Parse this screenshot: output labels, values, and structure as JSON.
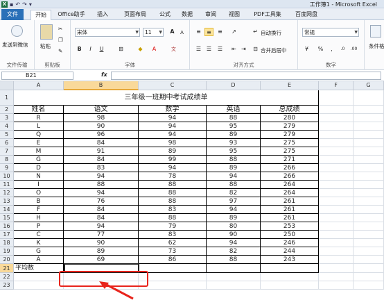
{
  "window": {
    "title": "工作簿1 - Microsoft Excel"
  },
  "tabs": [
    "文件",
    "开始",
    "Office助手",
    "插入",
    "页面布局",
    "公式",
    "数据",
    "审阅",
    "视图",
    "PDF工具集",
    "百度网盘"
  ],
  "ribbon": {
    "wechat": "发送到微信",
    "file_transfer": "文件传输",
    "paste": "粘贴",
    "clipboard": "剪贴板",
    "font_name": "宋体",
    "font_size": "11",
    "font_group": "字体",
    "wrap_text": "自动换行",
    "merge_center": "合并后居中",
    "alignment_group": "对齐方式",
    "number_format": "常规",
    "number_group": "数字",
    "conditional": "条件格",
    "bold": "B",
    "italic": "I",
    "underline": "U",
    "grow_font": "A",
    "shrink_font": "A"
  },
  "formula_bar": {
    "name_box": "B21",
    "fx": "fx",
    "value": ""
  },
  "columns": [
    "A",
    "B",
    "C",
    "D",
    "E",
    "F",
    "G"
  ],
  "rows": [
    "1",
    "2",
    "3",
    "4",
    "5",
    "6",
    "7",
    "8",
    "9",
    "10",
    "11",
    "12",
    "13",
    "14",
    "15",
    "16",
    "17",
    "18",
    "19",
    "20",
    "21",
    "22",
    "23"
  ],
  "sheet": {
    "title": "三年级一班期中考试成绩单",
    "headers": [
      "姓名",
      "语文",
      "数学",
      "英语",
      "总成绩"
    ],
    "records": [
      [
        "R",
        "98",
        "94",
        "88",
        "280"
      ],
      [
        "L",
        "90",
        "94",
        "95",
        "279"
      ],
      [
        "Q",
        "96",
        "94",
        "89",
        "279"
      ],
      [
        "E",
        "84",
        "98",
        "93",
        "275"
      ],
      [
        "M",
        "91",
        "89",
        "95",
        "275"
      ],
      [
        "G",
        "84",
        "99",
        "88",
        "271"
      ],
      [
        "D",
        "83",
        "94",
        "89",
        "266"
      ],
      [
        "N",
        "94",
        "78",
        "94",
        "266"
      ],
      [
        "I",
        "88",
        "88",
        "88",
        "264"
      ],
      [
        "O",
        "94",
        "88",
        "82",
        "264"
      ],
      [
        "B",
        "76",
        "88",
        "97",
        "261"
      ],
      [
        "F",
        "84",
        "83",
        "94",
        "261"
      ],
      [
        "H",
        "84",
        "88",
        "89",
        "261"
      ],
      [
        "P",
        "94",
        "79",
        "80",
        "253"
      ],
      [
        "C",
        "77",
        "83",
        "90",
        "250"
      ],
      [
        "K",
        "90",
        "62",
        "94",
        "246"
      ],
      [
        "G",
        "89",
        "73",
        "82",
        "244"
      ],
      [
        "A",
        "69",
        "86",
        "88",
        "243"
      ]
    ],
    "average_label": "平均数"
  }
}
